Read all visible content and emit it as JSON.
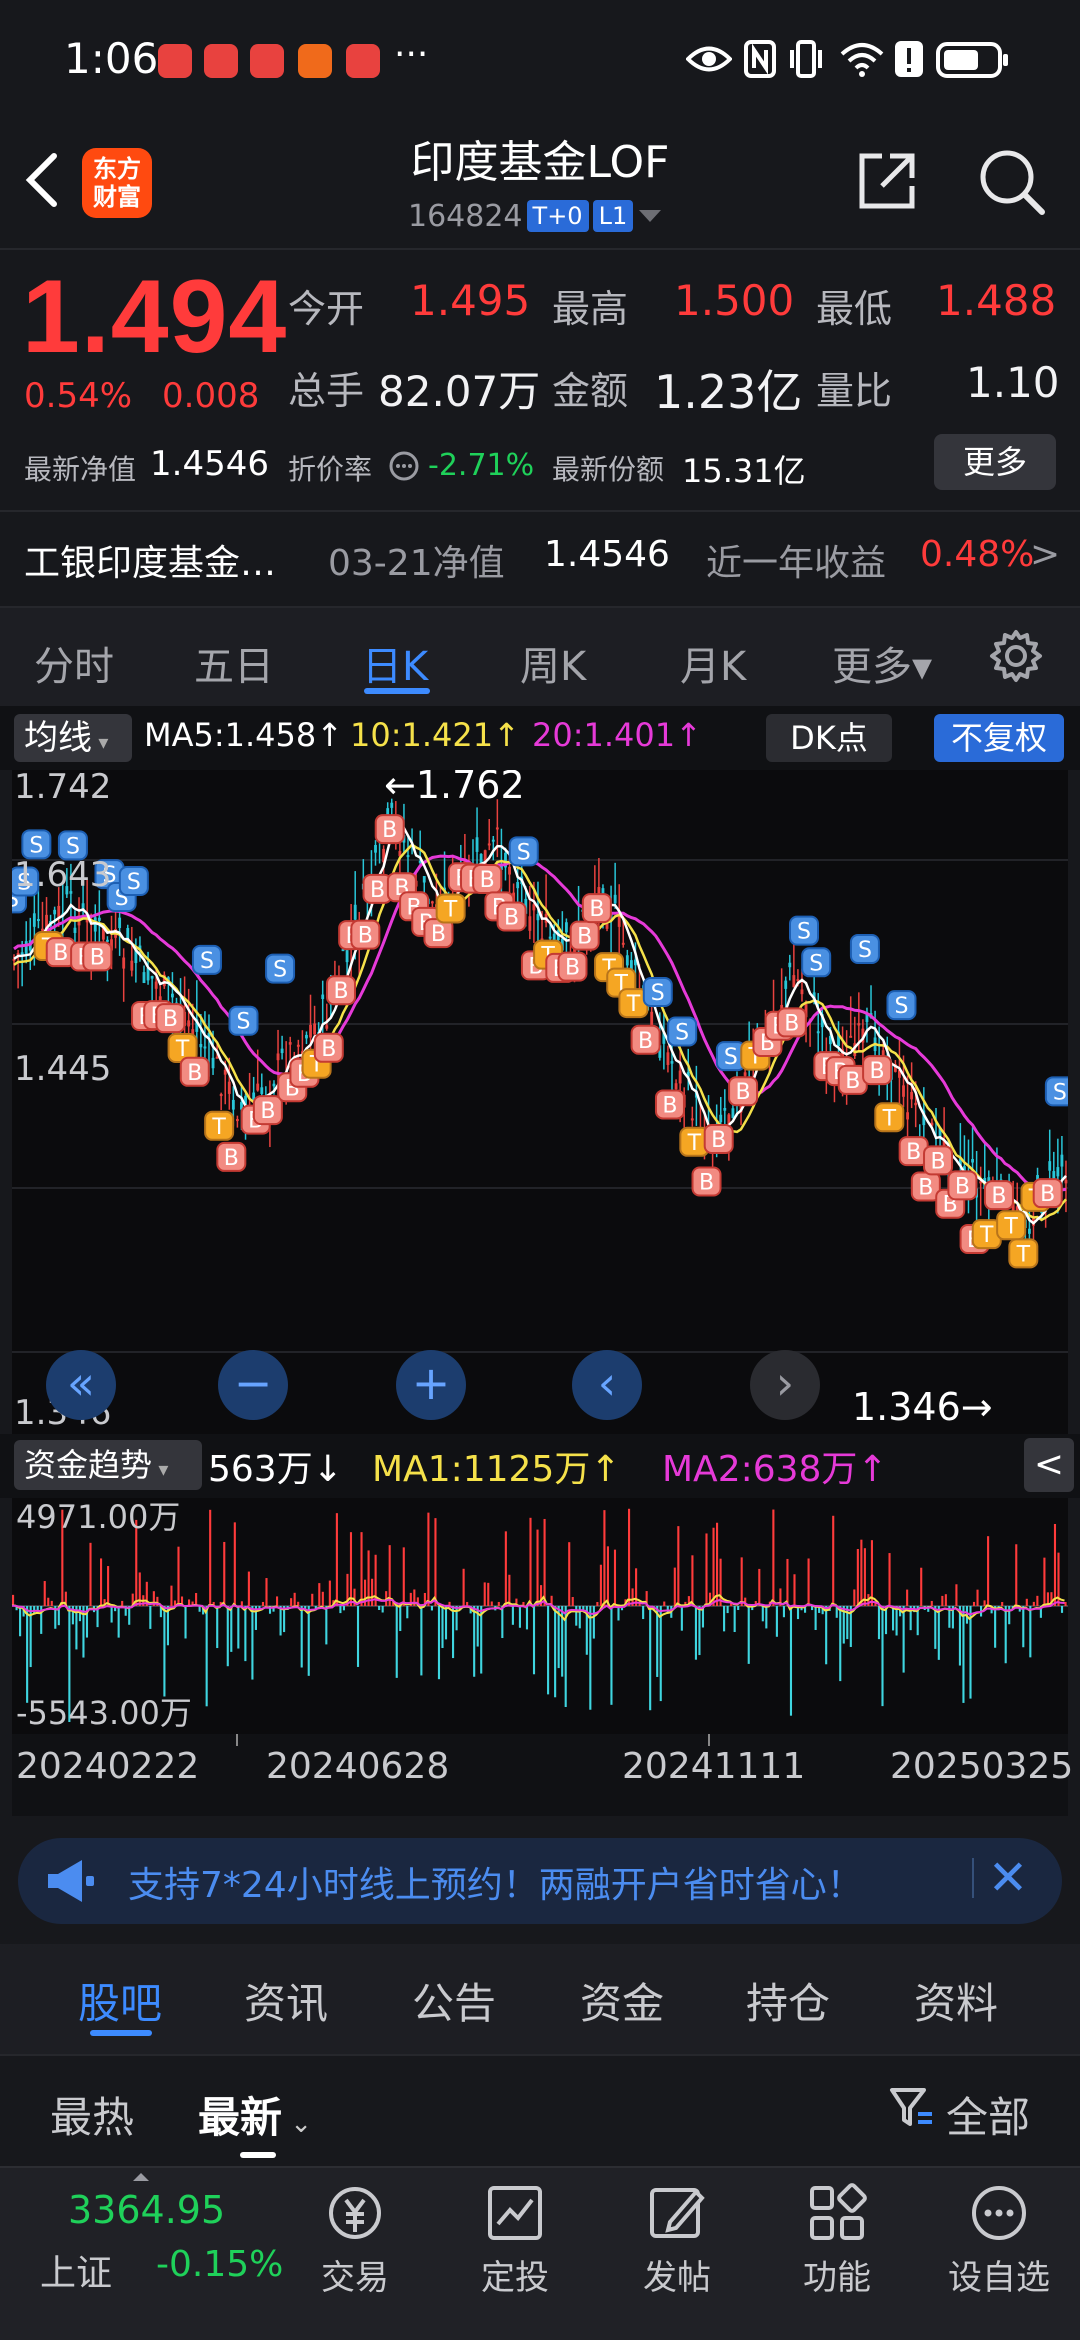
{
  "status_bar": {
    "time": "1:06",
    "ellipsis": "···"
  },
  "header": {
    "logo_line1": "东方",
    "logo_line2": "财富",
    "fund_name": "印度基金LOF",
    "fund_code": "164824",
    "tag_t0": "T+0",
    "tag_l1": "L1"
  },
  "quote": {
    "price": "1.494",
    "pct": "0.54%",
    "change": "0.008",
    "open_label": "今开",
    "open": "1.495",
    "high_label": "最高",
    "high": "1.500",
    "low_label": "最低",
    "low": "1.488",
    "volume_label": "总手",
    "volume": "82.07万",
    "amount_label": "金额",
    "amount": "1.23亿",
    "ratio_label": "量比",
    "ratio": "1.10",
    "nav_label": "最新净值",
    "nav": "1.4546",
    "discount_label": "折价率",
    "discount": "-2.71%",
    "shares_label": "最新份额",
    "shares": "15.31亿",
    "more_label": "更多"
  },
  "nav_row": {
    "name": "工银印度基金…",
    "date": "03-21净值",
    "value": "1.4546",
    "year_label": "近一年收益",
    "year_value": "0.48%",
    "arrow": ">"
  },
  "chart_tabs": [
    "分时",
    "五日",
    "日K",
    "周K",
    "月K",
    "更多▾"
  ],
  "ma_legend": {
    "select": "均线",
    "ma5": "MA5:1.458↑",
    "ma10": "10:1.421↑",
    "ma20": "20:1.401↑",
    "dk": "DK点",
    "adjust": "不复权"
  },
  "kchart": {
    "y_top": "1.742",
    "y_mid": "1.643",
    "y_low": "1.445",
    "y_bottom": "1.346",
    "max_mark": "←1.762",
    "min_mark": "1.346→",
    "controls": [
      "«",
      "−",
      "+",
      "‹",
      "›"
    ]
  },
  "flow": {
    "select": "资金趋势",
    "value": "563万↓",
    "ma1": "MA1:1125万↑",
    "ma2": "MA2:638万↑",
    "top": "4971.00万",
    "bottom": "-5543.00万",
    "collapse": "<"
  },
  "dates": [
    "20240222",
    "20240628",
    "20241111",
    "20250325"
  ],
  "banner": {
    "text": "支持7*24小时线上预约！两融开户省时省心！",
    "close": "✕"
  },
  "bottom_tabs": [
    "股吧",
    "资讯",
    "公告",
    "资金",
    "持仓",
    "资料"
  ],
  "sort": {
    "hot": "最热",
    "new": "最新",
    "all": "全部"
  },
  "index": {
    "value": "3364.95",
    "name": "上证",
    "change": "-0.15%"
  },
  "bottom_nav": [
    "交易",
    "定投",
    "发帖",
    "功能",
    "设自选"
  ],
  "colors": {
    "up": "#ff3b3b",
    "down": "#1fd15a",
    "accent": "#3d8bff",
    "ma5": "#ffffff",
    "ma10": "#f5e14a",
    "ma20": "#e63ad8",
    "flow_in": "#ff3b3b",
    "flow_out": "#3fd6e0"
  }
}
